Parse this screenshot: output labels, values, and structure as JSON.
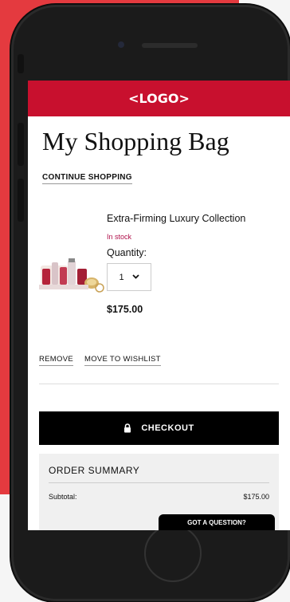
{
  "header": {
    "logo_text": "<LOGO>"
  },
  "page": {
    "title": "My Shopping Bag",
    "continue_label": "CONTINUE SHOPPING"
  },
  "cart": {
    "item": {
      "name": "Extra-Firming Luxury Collection",
      "stock_status": "In stock",
      "quantity_label": "Quantity:",
      "quantity_value": "1",
      "price": "$175.00",
      "remove_label": "REMOVE",
      "wishlist_label": "MOVE TO WISHLIST"
    }
  },
  "checkout": {
    "label": "CHECKOUT"
  },
  "summary": {
    "title": "ORDER SUMMARY",
    "subtotal_label": "Subtotal:",
    "subtotal_value": "$175.00"
  },
  "help": {
    "label": "GOT A QUESTION?"
  },
  "colors": {
    "brand_red": "#c8102e",
    "background_red": "#e43a3f",
    "stock_color": "#b0104a"
  },
  "icons": {
    "checkout_icon": "lock-icon",
    "quantity_icon": "chevron-down-icon"
  }
}
